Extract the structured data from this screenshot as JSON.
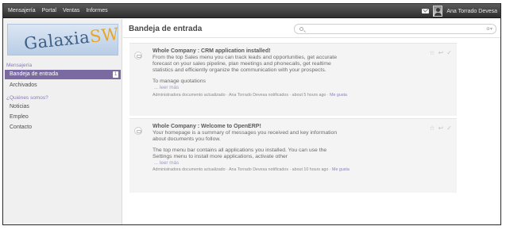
{
  "topbar": {
    "menu": [
      "Mensajería",
      "Portal",
      "Ventas",
      "Informes"
    ],
    "username": "Ana Torrado Devesa"
  },
  "sidebar": {
    "logo": {
      "main": "Galaxia",
      "suffix": "SW"
    },
    "section_messaging": "Mensajería",
    "inbox": "Bandeja de entrada",
    "inbox_count": "1",
    "archived": "Archivados",
    "section_about": "¿Quiénes somos?",
    "news": "Noticias",
    "jobs": "Empleo",
    "contact": "Contacto"
  },
  "main": {
    "title": "Bandeja de entrada",
    "threads": [
      {
        "title": "Whole Company : CRM application installed!",
        "lines": [
          "From the top Sales menu you can track leads and opportunities, get accurate",
          "forecast on your sales pipeline, plan meetings and phonecalls, get realtime",
          "statistics and efficiently organize the communication with your prospects."
        ],
        "lines2": [
          "To manage quotations"
        ],
        "read_more": "... leer más",
        "meta_text": "Administradora documento actualizado · Ana Torrado Devesa notificados · about 5 hours ago · ",
        "meta_link": "Me gusta"
      },
      {
        "title": "Whole Company : Welcome to OpenERP!",
        "lines": [
          "Your homepage is a summary of messages you received and key information",
          "about documents you follow."
        ],
        "lines2": [
          "The top menu bar contains all applications you installed. You can use the",
          "Settings menu to install more applications, activate other"
        ],
        "read_more": "... leer más",
        "meta_text": "Administradora documento actualizado · Ana Torrado Devesa notificados · about 10 hours ago · ",
        "meta_link": "Me gusta"
      }
    ]
  },
  "icons": {
    "star": "☆",
    "reply": "↩",
    "check": "✓",
    "filter": "⊕▾"
  }
}
